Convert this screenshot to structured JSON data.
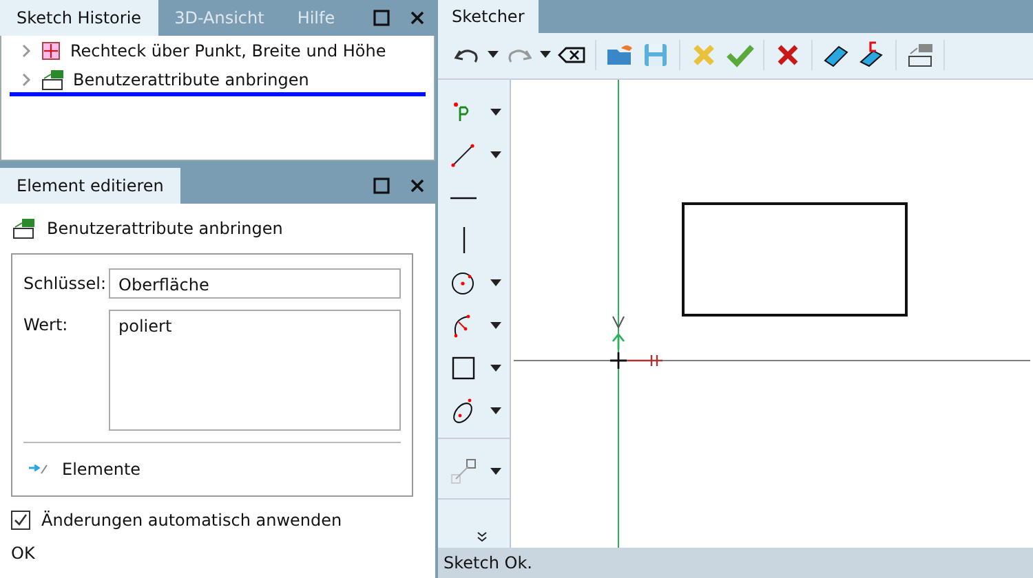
{
  "history_panel": {
    "tabs": [
      {
        "label": "Sketch Historie",
        "selected": true
      },
      {
        "label": "3D-Ansicht",
        "selected": false
      },
      {
        "label": "Hilfe",
        "selected": false
      }
    ],
    "items": [
      {
        "label": "Rechteck über Punkt, Breite und Höhe",
        "kind": "rect",
        "marker": false
      },
      {
        "label": "Benutzerattribute anbringen",
        "kind": "attribute",
        "marker": true
      }
    ]
  },
  "edit_panel": {
    "title": "Element editieren",
    "heading": "Benutzerattribute anbringen",
    "key_label": "Schlüssel:",
    "key_value": "Oberfläche",
    "value_label": "Wert:",
    "value_value": "poliert",
    "elements_label": "Elemente",
    "auto_apply": {
      "label": "Änderungen automatisch anwenden",
      "checked": true
    },
    "ok": "OK"
  },
  "sketcher": {
    "tab": "Sketcher",
    "toolbar": [
      [
        {
          "kind": "undo",
          "menu": true
        },
        {
          "kind": "redo",
          "menu": true
        },
        {
          "kind": "clear",
          "menu": false
        }
      ],
      [
        {
          "kind": "open",
          "menu": false
        },
        {
          "kind": "save",
          "menu": false
        }
      ],
      [
        {
          "kind": "partial",
          "menu": false
        },
        {
          "kind": "accept",
          "menu": false
        }
      ],
      [
        {
          "kind": "cancel",
          "menu": false
        }
      ],
      [
        {
          "kind": "erase",
          "menu": false
        },
        {
          "kind": "erase-c",
          "menu": false
        }
      ],
      [
        {
          "kind": "attribute",
          "menu": false
        }
      ]
    ],
    "tools": [
      [
        {
          "kind": "point",
          "menu": true
        },
        {
          "kind": "line",
          "menu": true
        },
        {
          "kind": "hline",
          "menu": false
        },
        {
          "kind": "vline",
          "menu": false
        },
        {
          "kind": "circle",
          "menu": true
        },
        {
          "kind": "arc",
          "menu": true
        },
        {
          "kind": "rect",
          "menu": true
        },
        {
          "kind": "ellipse",
          "menu": true
        }
      ],
      [
        {
          "kind": "construct",
          "menu": true
        }
      ]
    ],
    "status": "Sketch Ok."
  }
}
